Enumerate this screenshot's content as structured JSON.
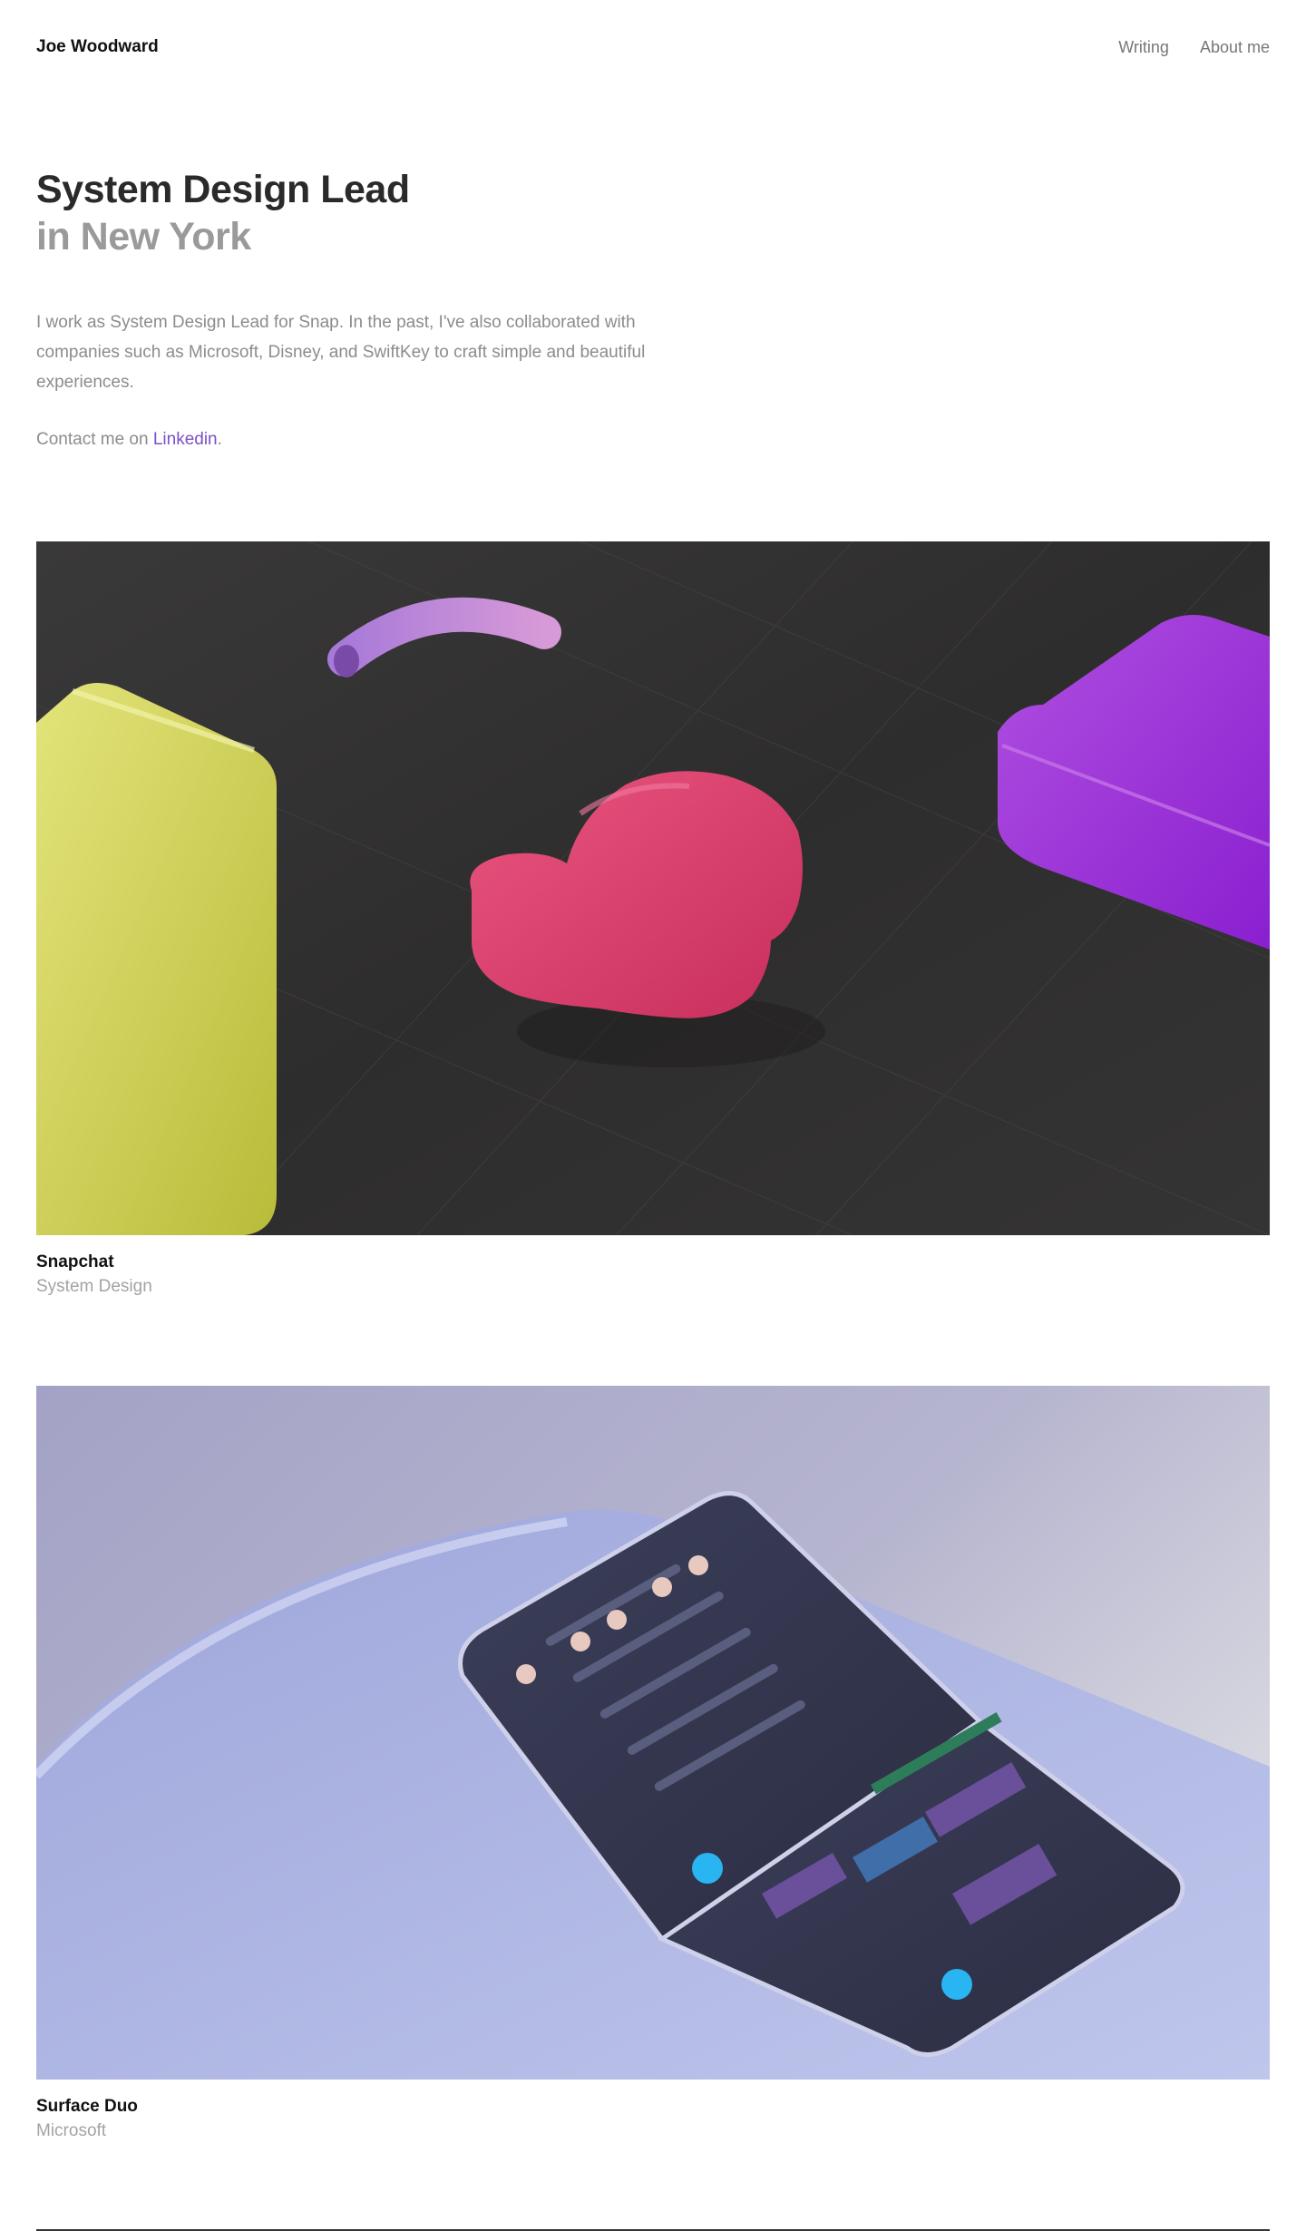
{
  "header": {
    "brand": "Joe Woodward",
    "nav": [
      {
        "label": "Writing"
      },
      {
        "label": "About me"
      }
    ]
  },
  "hero": {
    "title": "System Design Lead",
    "subtitle": "in New York",
    "bio": "I work as System Design Lead for Snap. In the past, I've also collaborated with companies such as Microsoft, Disney, and SwiftKey to craft simple and beautiful experiences.",
    "contact_prefix": "Contact me on ",
    "contact_link": "Linkedin",
    "contact_suffix": "."
  },
  "projects": [
    {
      "title": "Snapchat",
      "meta": "System Design"
    },
    {
      "title": "Surface Duo",
      "meta": "Microsoft"
    }
  ],
  "colors": {
    "accent_link": "#7a4fc9",
    "muted_text": "#8c8c8c",
    "heading": "#2a2a2a"
  }
}
